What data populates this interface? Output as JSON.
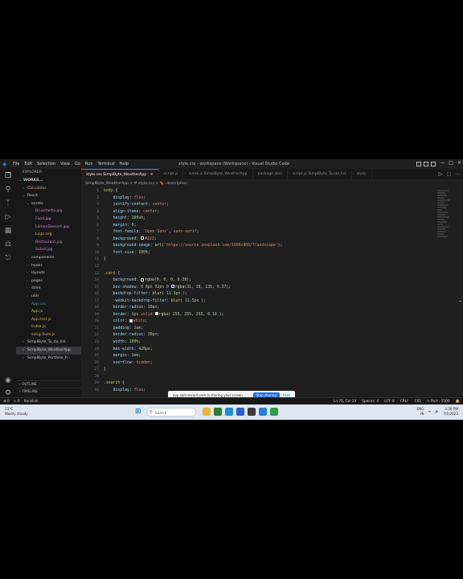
{
  "window": {
    "title": "style.css - workspace (Workspace) - Visual Studio Code",
    "menu": [
      "File",
      "Edit",
      "Selection",
      "View",
      "Go",
      "Run",
      "Terminal",
      "Help"
    ],
    "controls": [
      "—",
      "□",
      "✕"
    ]
  },
  "activity_bar": {
    "top": [
      "files-icon",
      "search-icon",
      "source-control-icon",
      "run-debug-icon",
      "extensions-icon",
      "flask-icon",
      "remote-icon"
    ],
    "bottom": [
      "account-icon",
      "settings-icon"
    ]
  },
  "sidebar": {
    "header": "EXPLORER",
    "workspace": "WORKS...",
    "items": [
      {
        "label": "Calculator",
        "depth": 1,
        "twisty": "›",
        "color": "#e2a35a"
      },
      {
        "label": "React",
        "depth": 1,
        "twisty": "⌄",
        "color": "#cccccc"
      },
      {
        "label": "assets",
        "depth": 2,
        "twisty": "⌄",
        "color": "#cccccc"
      },
      {
        "label": "Bruschetta.jpg",
        "depth": 3,
        "twisty": "",
        "color": "#c586c0"
      },
      {
        "label": "Food.jpg",
        "depth": 3,
        "twisty": "",
        "color": "#c586c0"
      },
      {
        "label": "LemonDessert.jpg",
        "depth": 3,
        "twisty": "",
        "color": "#c586c0"
      },
      {
        "label": "Logo.svg",
        "depth": 3,
        "twisty": "",
        "color": "#e2a35a"
      },
      {
        "label": "Restaurant.jpg",
        "depth": 3,
        "twisty": "",
        "color": "#c586c0"
      },
      {
        "label": "Salad.jpg",
        "depth": 3,
        "twisty": "",
        "color": "#c586c0"
      },
      {
        "label": "components",
        "depth": 2,
        "twisty": "›",
        "color": "#cccccc"
      },
      {
        "label": "hooks",
        "depth": 2,
        "twisty": "›",
        "color": "#cccccc"
      },
      {
        "label": "layouts",
        "depth": 2,
        "twisty": "›",
        "color": "#cccccc"
      },
      {
        "label": "pages",
        "depth": 2,
        "twisty": "›",
        "color": "#cccccc"
      },
      {
        "label": "store",
        "depth": 2,
        "twisty": "›",
        "color": "#cccccc"
      },
      {
        "label": "utils",
        "depth": 2,
        "twisty": "›",
        "color": "#cccccc"
      },
      {
        "label": "App.css",
        "depth": 2,
        "twisty": "",
        "color": "#519aba"
      },
      {
        "label": "App.js",
        "depth": 2,
        "twisty": "",
        "color": "#d8c057"
      },
      {
        "label": "App.test.js",
        "depth": 2,
        "twisty": "",
        "color": "#e2a35a"
      },
      {
        "label": "index.js",
        "depth": 2,
        "twisty": "",
        "color": "#d8c057"
      },
      {
        "label": "setupTests.js",
        "depth": 2,
        "twisty": "",
        "color": "#e2a35a"
      },
      {
        "label": "SimplByte_To_do_list",
        "depth": 1,
        "twisty": "›",
        "color": "#cccccc"
      },
      {
        "label": "SimplByte_WeatherApp",
        "depth": 1,
        "twisty": "›",
        "color": "#cccccc",
        "selected": true
      },
      {
        "label": "SimplByte_Portfolio_P...",
        "depth": 1,
        "twisty": "›",
        "color": "#cccccc"
      }
    ],
    "outline": "OUTLINE",
    "timeline": "TIMELINE"
  },
  "tabs": [
    {
      "label": "style.css  SimplByte_WeatherApp",
      "active": true,
      "close": "✕"
    },
    {
      "label": "script.js",
      "active": false
    },
    {
      "label": "index.js  SimplByte_WeatherApp",
      "active": false
    },
    {
      "label": "package.json",
      "active": false
    },
    {
      "label": "script.js  SimplByte_To_do_list",
      "active": false
    },
    {
      "label": "style.",
      "active": false
    }
  ],
  "tab_actions": [
    "▷",
    "⬚",
    "⋯"
  ],
  "breadcrumb": "SimplByte_WeatherApp  >  # style.css  >  🔖 .description",
  "code_lines": [
    {
      "n": "1",
      "html": "<span class=sel>body</span> <span class=pun>{</span>"
    },
    {
      "n": "2",
      "html": "    <span class=prop>display</span><span class=pun>:</span> <span class=val>flex</span><span class=pun>;</span>"
    },
    {
      "n": "3",
      "html": "    <span class=prop>justify-content</span><span class=pun>:</span> <span class=val>center</span><span class=pun>;</span>"
    },
    {
      "n": "4",
      "html": "    <span class=prop>align-items</span><span class=pun>:</span> <span class=val>center</span><span class=pun>;</span>"
    },
    {
      "n": "5",
      "html": "    <span class=prop>height</span><span class=pun>:</span> <span class=num>100vh</span><span class=pun>;</span>"
    },
    {
      "n": "6",
      "html": "    <span class=prop>margin</span><span class=pun>:</span> <span class=num>0</span><span class=pun>;</span>"
    },
    {
      "n": "7",
      "html": "    <span class=prop>font-family</span><span class=pun>:</span> <span class=val>'Open Sans'</span><span class=pun>,</span> <span class=val>sans-serif</span><span class=pun>;</span>"
    },
    {
      "n": "8",
      "html": "    <span class=prop>background</span><span class=pun>:</span> <span class=swatch style='background:#222'></span><span class=val>#222</span><span class=pun>;</span>"
    },
    {
      "n": "9",
      "html": "    <span class=prop>background-image</span><span class=pun>:</span> <span class=fn>url</span><span class=pun>(</span><span class=val>'https://source.unsplash.com/1600x900/?landscape'</span><span class=pun>);</span>"
    },
    {
      "n": "10",
      "html": "    <span class=prop>font-size</span><span class=pun>:</span> <span class=num>100%</span><span class=pun>;</span>"
    },
    {
      "n": "11",
      "html": "<span class=pun>}</span>"
    },
    {
      "n": "12",
      "html": ""
    },
    {
      "n": "13",
      "html": "<span class=sel>.card</span> <span class=pun>{</span>"
    },
    {
      "n": "14",
      "html": "    <span class=prop>background</span><span class=pun>:</span> <span class=swatch style='background:#000'></span><span class=fn>rgba</span><span class=pun>(</span><span class=num>0, 0, 0, 0.38</span><span class=pun>);</span>"
    },
    {
      "n": "15",
      "html": "    <span class=prop>box-shadow</span><span class=pun>:</span> <span class=num>0 8px 32px 0</span> <span class=swatch style='background:#1f2687'></span><span class=fn>rgba</span><span class=pun>(</span><span class=num>31, 38, 135, 0.37</span><span class=pun>);</span>"
    },
    {
      "n": "16",
      "html": "    <span class=prop>backdrop-filter</span><span class=pun>:</span> <span class=fn>blur</span><span class=pun>(</span> <span class=num>11.5px</span> <span class=pun>);</span>"
    },
    {
      "n": "17",
      "html": "    <span class=prop>-webkit-backdrop-filter</span><span class=pun>:</span> <span class=fn>blur</span><span class=pun>(</span> <span class=num>11.5px</span> <span class=pun>);</span>"
    },
    {
      "n": "18",
      "html": "    <span class=prop>border-radius</span><span class=pun>:</span> <span class=num>10px</span><span class=pun>;</span>"
    },
    {
      "n": "19",
      "html": "    <span class=prop>border</span><span class=pun>:</span> <span class=num>1px</span> <span class=val>solid</span> <span class=swatch style='background:#fff'></span><span class=fn>rgba</span><span class=pun>(</span> <span class=num>255, 255, 255, 0.18</span> <span class=pun>);</span>"
    },
    {
      "n": "20",
      "html": "    <span class=prop>color</span><span class=pun>:</span> <span class=swatch style='background:#fff'></span><span class=val>white</span><span class=pun>;</span>"
    },
    {
      "n": "21",
      "html": "    <span class=prop>padding</span><span class=pun>:</span> <span class=num>2em</span><span class=pun>;</span>"
    },
    {
      "n": "22",
      "html": "    <span class=prop>border-radius</span><span class=pun>:</span> <span class=num>30px</span><span class=pun>;</span>"
    },
    {
      "n": "23",
      "html": "    <span class=prop>width</span><span class=pun>:</span> <span class=num>100%</span><span class=pun>;</span>"
    },
    {
      "n": "24",
      "html": "    <span class=prop>max-width</span><span class=pun>:</span> <span class=num>420px</span><span class=pun>;</span>"
    },
    {
      "n": "25",
      "html": "    <span class=prop>margin</span><span class=pun>:</span> <span class=num>1em</span><span class=pun>;</span>"
    },
    {
      "n": "26",
      "html": "    <span class=prop>overflow</span><span class=pun>:</span> <span class=val>hidden</span><span class=pun>;</span>"
    },
    {
      "n": "27",
      "html": "<span class=pun>}</span>"
    },
    {
      "n": "28",
      "html": ""
    },
    {
      "n": "29",
      "html": "<span class=sel>.search</span> <span class=pun>{</span>"
    },
    {
      "n": "30",
      "html": "    <span class=prop>display</span><span class=pun>:</span> <span class=val>flex</span><span class=pun>;</span>"
    }
  ],
  "share_banner": {
    "message": "app.sprinrecord.com is sharing your screen",
    "stop_label": "Stop sharing",
    "hide_label": "Hide"
  },
  "status_bar": {
    "left": [
      "⊗ 0",
      "⚠ 0",
      "Backlink"
    ],
    "right": [
      "Ln 76, Col 23",
      "Spaces: 4",
      "UTF-8",
      "CRLF",
      "CSS",
      "⊙ Port : 5500",
      "🔔"
    ]
  },
  "taskbar": {
    "weather_temp": "23°C",
    "weather_desc": "Mostly cloudy",
    "search_placeholder": "Search",
    "apps": [
      {
        "name": "file-explorer-icon",
        "color": "#e8b73a"
      },
      {
        "name": "chrome-icon",
        "color": "#2e7d32"
      },
      {
        "name": "edge-icon",
        "color": "#1f8fd6"
      },
      {
        "name": "mail-icon",
        "color": "#2b5fd1"
      },
      {
        "name": "store-icon",
        "color": "#3a3a3a"
      },
      {
        "name": "vscode-icon",
        "color": "#2a7fd4"
      },
      {
        "name": "recorder-icon",
        "color": "#2f9e44"
      }
    ],
    "lang": "ENG",
    "region": "IN",
    "time": "3:30 PM",
    "date": "7/1/2023"
  }
}
